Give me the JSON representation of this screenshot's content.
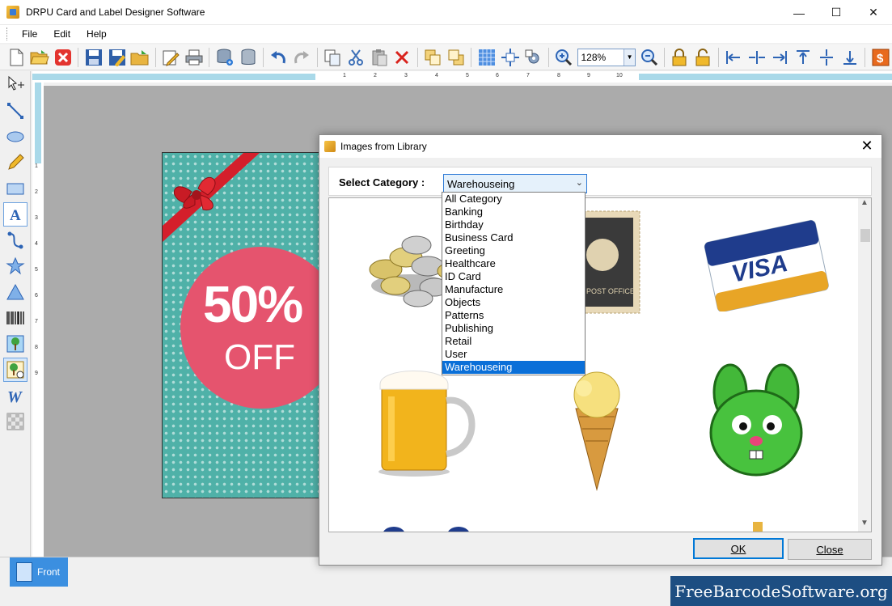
{
  "window": {
    "title": "DRPU Card and Label Designer Software",
    "minimize": "—",
    "maximize": "☐",
    "close": "✕"
  },
  "menu": [
    "File",
    "Edit",
    "Help"
  ],
  "toolbar": {
    "zoom_value": "128%",
    "buttons": [
      "new-icon",
      "open-icon",
      "close-file-icon",
      "save-icon",
      "save-as-icon",
      "export-icon",
      "edit-icon",
      "print-icon",
      "database-add-icon",
      "database-icon",
      "undo-icon",
      "redo-icon",
      "copy-icon",
      "cut-icon",
      "paste-icon",
      "delete-icon",
      "bring-front-icon",
      "send-back-icon",
      "grid-icon",
      "center-icon",
      "settings-icon",
      "zoom-in-icon",
      "zoom-out-icon",
      "lock-icon",
      "unlock-icon",
      "align-left-icon",
      "align-center-icon",
      "align-right-icon",
      "align-top-icon",
      "align-middle-icon",
      "align-bottom-icon",
      "price-icon"
    ]
  },
  "ruler": {
    "labels": [
      "1",
      "2",
      "3",
      "4",
      "5",
      "6",
      "7",
      "8",
      "9",
      "10"
    ],
    "vlabels": [
      "1",
      "2",
      "3",
      "4",
      "5",
      "6",
      "7",
      "8",
      "9"
    ]
  },
  "tools": [
    "pointer-tool-icon",
    "line-tool-icon",
    "ellipse-tool-icon",
    "pencil-tool-icon",
    "rectangle-tool-icon",
    "text-tool-icon",
    "curve-tool-icon",
    "star-tool-icon",
    "triangle-tool-icon",
    "barcode-tool-icon",
    "image-tool-icon",
    "image-library-tool-icon",
    "wordart-tool-icon",
    "watermark-tool-icon"
  ],
  "card": {
    "percent": "50%",
    "off": "OFF",
    "colors": {
      "background": "#4fb1a8",
      "circle": "#e5546e",
      "ribbon": "#d41f2b"
    }
  },
  "tabs": {
    "front": "Front"
  },
  "watermark": "FreeBarcodeSoftware.org",
  "dialog": {
    "title": "Images from Library",
    "close": "✕",
    "category_label": "Select Category :",
    "selected": "Warehouseing",
    "options": [
      "All Category",
      "Banking",
      "Birthday",
      "Business Card",
      "Greeting",
      "Healthcare",
      "ID Card",
      "Manufacture",
      "Objects",
      "Patterns",
      "Publishing",
      "Retail",
      "User",
      "Warehouseing"
    ],
    "visa_text": "VISA",
    "ok": "OK",
    "close_button": "Close",
    "images": [
      "coins-image",
      "postage-stamp-image",
      "visa-card-image",
      "beer-mug-image",
      "ice-cream-cone-image",
      "green-bunny-image"
    ]
  }
}
